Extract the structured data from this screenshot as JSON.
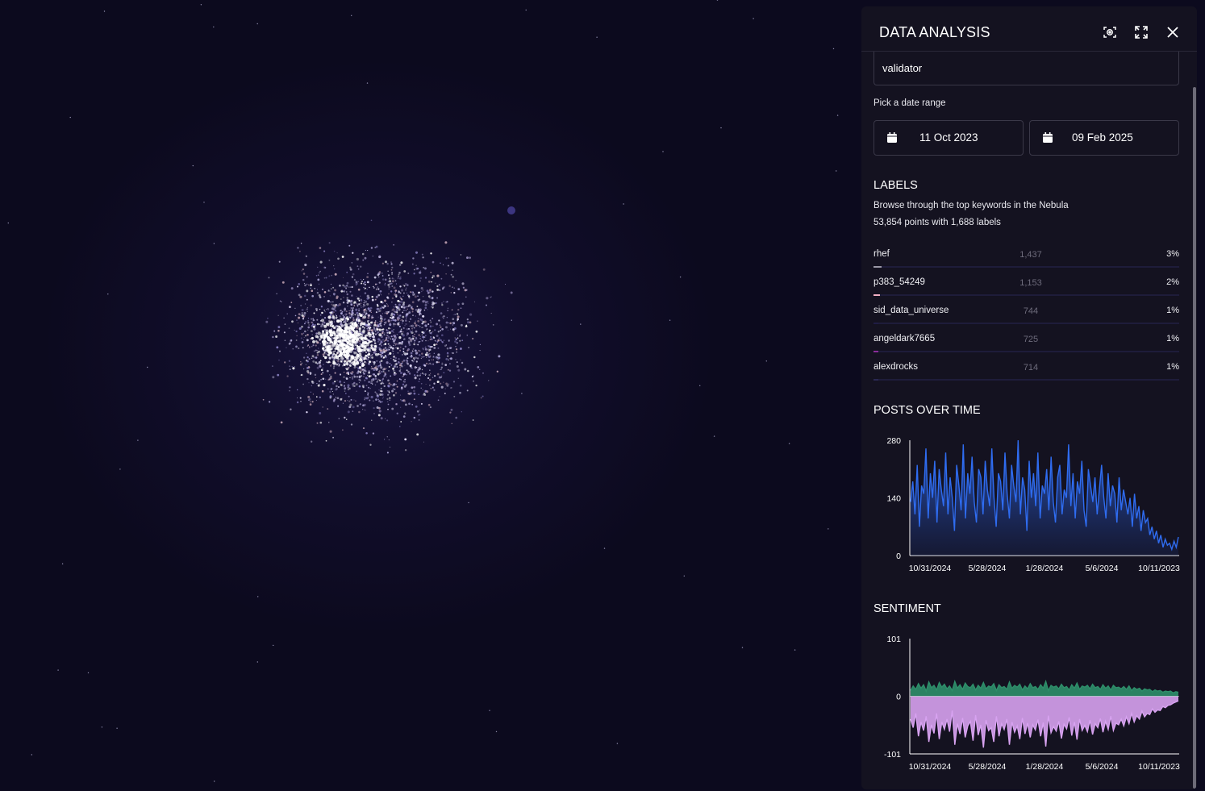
{
  "panel": {
    "title": "DATA ANALYSIS",
    "icons": {
      "screenshot": "focus-camera-icon",
      "fullscreen": "expand-icon",
      "close": "close-icon"
    }
  },
  "filter": {
    "value": "validator"
  },
  "date_range": {
    "label": "Pick a date range",
    "start": "11 Oct 2023",
    "end": "09 Feb 2025"
  },
  "labels": {
    "title": "LABELS",
    "description": "Browse through the top keywords in the Nebula",
    "summary": "53,854 points with 1,688 labels",
    "items": [
      {
        "name": "rhef",
        "count": "1,437",
        "pct": "3%",
        "share": 0.027,
        "color": "#9a98a6"
      },
      {
        "name": "p383_54249",
        "count": "1,153",
        "pct": "2%",
        "share": 0.021,
        "color": "#f2b0c4"
      },
      {
        "name": "sid_data_universe",
        "count": "744",
        "pct": "1%",
        "share": 0.014,
        "color": "#1f1c44"
      },
      {
        "name": "angeldark7665",
        "count": "725",
        "pct": "1%",
        "share": 0.013,
        "color": "#8a2d9a"
      },
      {
        "name": "alexdrocks",
        "count": "714",
        "pct": "1%",
        "share": 0.013,
        "color": "#2a2852"
      }
    ]
  },
  "posts_chart": {
    "title": "POSTS OVER TIME"
  },
  "sentiment_chart": {
    "title": "SENTIMENT"
  },
  "chart_data": [
    {
      "type": "area",
      "title": "POSTS OVER TIME",
      "xlabel": "",
      "ylabel": "",
      "ylim": [
        0,
        280
      ],
      "yticks": [
        "280",
        "140",
        "0"
      ],
      "xticks": [
        "10/31/2024",
        "5/28/2024",
        "1/28/2024",
        "5/6/2024",
        "10/11/2023"
      ],
      "x_start": "10/31/2024",
      "x_end": "10/11/2023",
      "series": [
        {
          "color": "#2f6cf0",
          "values": [
            130,
            180,
            100,
            220,
            70,
            170,
            150,
            260,
            90,
            200,
            140,
            230,
            80,
            210,
            160,
            120,
            250,
            100,
            190,
            140,
            60,
            220,
            170,
            110,
            270,
            90,
            200,
            150,
            240,
            130,
            80,
            210,
            190,
            100,
            230,
            160,
            120,
            260,
            140,
            70,
            200,
            180,
            110,
            250,
            150,
            90,
            220,
            170,
            130,
            280,
            100,
            190,
            160,
            60,
            230,
            140,
            200,
            120,
            250,
            90,
            170,
            150,
            210,
            110,
            240,
            130,
            80,
            190,
            220,
            100,
            160,
            140,
            270,
            120,
            200,
            90,
            180,
            150,
            230,
            110,
            70,
            210,
            170,
            130,
            190,
            100,
            160,
            220,
            140,
            90,
            200,
            120,
            170,
            150,
            80,
            190,
            110,
            160,
            130,
            100,
            140,
            70,
            150,
            90,
            120,
            60,
            110,
            80,
            90,
            50,
            70,
            40,
            60,
            30,
            50,
            20,
            40,
            25,
            30,
            15,
            35,
            20,
            45
          ]
        }
      ]
    },
    {
      "type": "area",
      "title": "SENTIMENT",
      "xlabel": "",
      "ylabel": "",
      "ylim": [
        -101,
        101
      ],
      "yticks": [
        "101",
        "0",
        "-101"
      ],
      "xticks": [
        "10/31/2024",
        "5/28/2024",
        "1/28/2024",
        "5/6/2024",
        "10/11/2023"
      ],
      "series": [
        {
          "color": "#2e8f6a",
          "values": [
            10,
            18,
            12,
            22,
            14,
            20,
            9,
            25,
            15,
            19,
            11,
            24,
            16,
            21,
            13,
            18,
            10,
            26,
            14,
            20,
            12,
            23,
            17,
            15,
            21,
            11,
            19,
            14,
            24,
            13,
            18,
            16,
            22,
            10,
            20,
            15,
            17,
            12,
            25,
            14,
            19,
            16,
            21,
            11,
            18,
            13,
            22,
            15,
            17,
            12,
            20,
            14,
            26,
            10,
            19,
            16,
            18,
            13,
            21,
            15,
            17,
            11,
            20,
            14,
            23,
            12,
            18,
            16,
            19,
            13,
            21,
            15,
            17,
            12,
            20,
            14,
            18,
            11,
            19,
            15,
            16,
            13,
            17,
            12,
            18,
            10,
            15,
            12,
            14,
            9,
            13,
            11,
            12,
            8,
            11,
            9,
            10,
            7,
            9,
            8,
            9,
            6,
            8,
            7
          ]
        },
        {
          "color": "#d7a2f0",
          "values": [
            -40,
            -55,
            -30,
            -70,
            -45,
            -60,
            -35,
            -80,
            -50,
            -65,
            -30,
            -75,
            -45,
            -58,
            -40,
            -62,
            -25,
            -85,
            -48,
            -66,
            -38,
            -72,
            -52,
            -44,
            -78,
            -33,
            -68,
            -50,
            -90,
            -42,
            -60,
            -55,
            -80,
            -35,
            -70,
            -48,
            -58,
            -40,
            -85,
            -45,
            -63,
            -52,
            -75,
            -38,
            -66,
            -47,
            -72,
            -50,
            -59,
            -41,
            -70,
            -46,
            -88,
            -34,
            -64,
            -53,
            -61,
            -44,
            -74,
            -49,
            -57,
            -37,
            -69,
            -45,
            -76,
            -40,
            -60,
            -51,
            -62,
            -42,
            -67,
            -48,
            -55,
            -39,
            -63,
            -44,
            -58,
            -35,
            -60,
            -47,
            -50,
            -40,
            -52,
            -36,
            -48,
            -30,
            -45,
            -34,
            -40,
            -26,
            -36,
            -30,
            -32,
            -22,
            -28,
            -24,
            -25,
            -18,
            -20,
            -16,
            -15,
            -12,
            -10,
            -8
          ]
        }
      ]
    }
  ]
}
